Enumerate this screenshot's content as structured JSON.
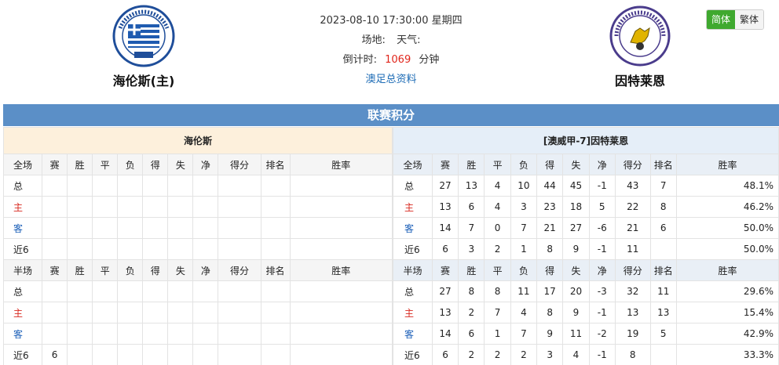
{
  "match": {
    "datetime": "2023-08-10 17:30:00 星期四",
    "venue_label": "场地:",
    "weather_label": "天气:",
    "countdown_label": "倒计时:",
    "countdown_value": "1069",
    "countdown_unit": "分钟",
    "league_link": "澳足总资料"
  },
  "home_team": {
    "name": "海伦斯(主)"
  },
  "away_team": {
    "name": "因特莱恩"
  },
  "lang": {
    "simplified": "简体",
    "traditional": "繁体"
  },
  "section_title": "联赛积分",
  "left_table": {
    "title": "海伦斯",
    "full_header": [
      "全场",
      "赛",
      "胜",
      "平",
      "负",
      "得",
      "失",
      "净",
      "得分",
      "排名",
      "胜率"
    ],
    "half_header": [
      "半场",
      "赛",
      "胜",
      "平",
      "负",
      "得",
      "失",
      "净",
      "得分",
      "排名",
      "胜率"
    ],
    "full_rows": [
      [
        "总",
        "",
        "",
        "",
        "",
        "",
        "",
        "",
        "",
        "",
        ""
      ],
      [
        "主",
        "",
        "",
        "",
        "",
        "",
        "",
        "",
        "",
        "",
        ""
      ],
      [
        "客",
        "",
        "",
        "",
        "",
        "",
        "",
        "",
        "",
        "",
        ""
      ],
      [
        "近6",
        "",
        "",
        "",
        "",
        "",
        "",
        "",
        "",
        "",
        ""
      ]
    ],
    "half_rows": [
      [
        "总",
        "",
        "",
        "",
        "",
        "",
        "",
        "",
        "",
        "",
        ""
      ],
      [
        "主",
        "",
        "",
        "",
        "",
        "",
        "",
        "",
        "",
        "",
        ""
      ],
      [
        "客",
        "",
        "",
        "",
        "",
        "",
        "",
        "",
        "",
        "",
        ""
      ],
      [
        "近6",
        "6",
        "",
        "",
        "",
        "",
        "",
        "",
        "",
        "",
        ""
      ]
    ]
  },
  "right_table": {
    "title": "[澳威甲-7]因特莱恩",
    "full_header": [
      "全场",
      "赛",
      "胜",
      "平",
      "负",
      "得",
      "失",
      "净",
      "得分",
      "排名",
      "胜率"
    ],
    "half_header": [
      "半场",
      "赛",
      "胜",
      "平",
      "负",
      "得",
      "失",
      "净",
      "得分",
      "排名",
      "胜率"
    ],
    "full_rows": [
      [
        "总",
        "27",
        "13",
        "4",
        "10",
        "44",
        "45",
        "-1",
        "43",
        "7",
        "48.1%"
      ],
      [
        "主",
        "13",
        "6",
        "4",
        "3",
        "23",
        "18",
        "5",
        "22",
        "8",
        "46.2%"
      ],
      [
        "客",
        "14",
        "7",
        "0",
        "7",
        "21",
        "27",
        "-6",
        "21",
        "6",
        "50.0%"
      ],
      [
        "近6",
        "6",
        "3",
        "2",
        "1",
        "8",
        "9",
        "-1",
        "11",
        "",
        "50.0%"
      ]
    ],
    "half_rows": [
      [
        "总",
        "27",
        "8",
        "8",
        "11",
        "17",
        "20",
        "-3",
        "32",
        "11",
        "29.6%"
      ],
      [
        "主",
        "13",
        "2",
        "7",
        "4",
        "8",
        "9",
        "-1",
        "13",
        "13",
        "15.4%"
      ],
      [
        "客",
        "14",
        "6",
        "1",
        "7",
        "9",
        "11",
        "-2",
        "19",
        "5",
        "42.9%"
      ],
      [
        "近6",
        "6",
        "2",
        "2",
        "2",
        "3",
        "4",
        "-1",
        "8",
        "",
        "33.3%"
      ]
    ]
  }
}
